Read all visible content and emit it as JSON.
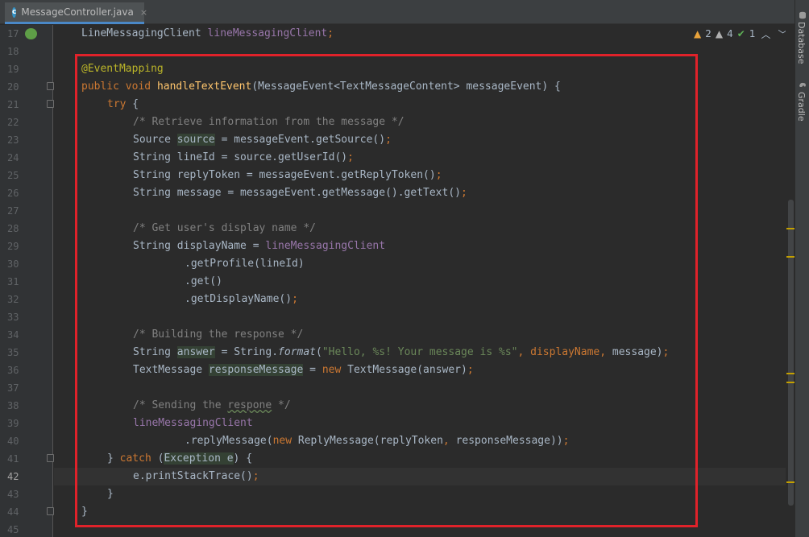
{
  "tab": {
    "title": "MessageController.java",
    "icon_letter": "c",
    "close": "×"
  },
  "inspections": {
    "warnings": "2",
    "weak_warnings": "4",
    "ok": "1"
  },
  "sidebar": {
    "database": "Database",
    "gradle": "Gradle"
  },
  "line_numbers": [
    "17",
    "18",
    "19",
    "20",
    "21",
    "22",
    "23",
    "24",
    "25",
    "26",
    "27",
    "28",
    "29",
    "30",
    "31",
    "32",
    "33",
    "34",
    "35",
    "36",
    "37",
    "38",
    "39",
    "40",
    "41",
    "42",
    "43",
    "44",
    "45"
  ],
  "current_line": "42",
  "code": {
    "l17": {
      "a": "LineMessagingClient ",
      "b": "lineMessagingClient",
      "c": ";"
    },
    "l19": {
      "a": "@EventMapping"
    },
    "l20": {
      "a": "public ",
      "b": "void ",
      "c": "handleTextEvent",
      "d": "(MessageEvent<TextMessageContent> messageEvent) {"
    },
    "l21": {
      "a": "try",
      "b": " {"
    },
    "l22": {
      "a": "/* Retrieve information from the message */"
    },
    "l23": {
      "a": "Source ",
      "b": "source",
      "c": " = messageEvent.getSource()",
      "d": ";"
    },
    "l24": {
      "a": "String lineId = source.getUserId()",
      "b": ";"
    },
    "l25": {
      "a": "String replyToken = messageEvent.getReplyToken()",
      "b": ";"
    },
    "l26": {
      "a": "String message = messageEvent.getMessage().getText()",
      "b": ";"
    },
    "l28": {
      "a": "/* Get user's display name */"
    },
    "l29": {
      "a": "String displayName = ",
      "b": "lineMessagingClient"
    },
    "l30": {
      "a": ".getProfile(lineId)"
    },
    "l31": {
      "a": ".get()"
    },
    "l32": {
      "a": ".getDisplayName()",
      "b": ";"
    },
    "l34": {
      "a": "/* Building the response */"
    },
    "l35": {
      "a": "String ",
      "b": "answer",
      "c": " = String.",
      "d": "format",
      "e": "(",
      "f": "\"Hello, %s! Your message is %s\"",
      "g": ", displayName",
      "h": ", ",
      "i": "message)",
      "j": ";"
    },
    "l36": {
      "a": "TextMessage ",
      "b": "responseMessage",
      "c": " = ",
      "d": "new ",
      "e": "TextMessage(answer)",
      "f": ";"
    },
    "l38": {
      "a": "/* Sending the ",
      "b": "respone",
      "c": " */"
    },
    "l39": {
      "a": "lineMessagingClient"
    },
    "l40": {
      "a": ".replyMessage(",
      "b": "new ",
      "c": "ReplyMessage(replyToken",
      "d": ", ",
      "e": "responseMessage))",
      "f": ";"
    },
    "l41": {
      "a": "} ",
      "b": "catch ",
      "c": "(",
      "d": "Exception e",
      "e": ") {"
    },
    "l42": {
      "a": "e.printStackTrace()",
      "b": ";"
    },
    "l43": {
      "a": "}"
    },
    "l44": {
      "a": "}"
    }
  }
}
